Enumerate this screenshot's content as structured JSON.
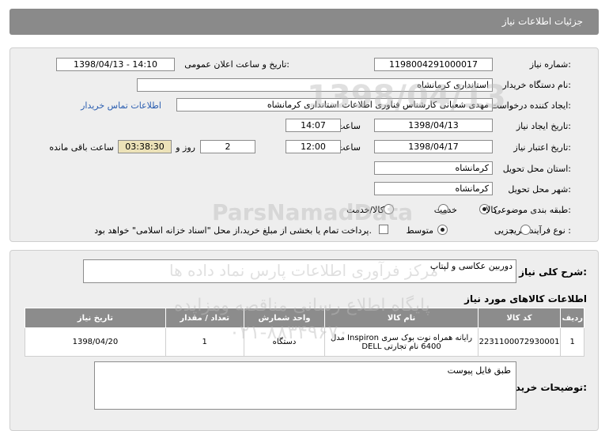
{
  "header": {
    "title": "جزئیات اطلاعات نیاز"
  },
  "form": {
    "need_number_label": "شماره نیاز:",
    "need_number": "1198004291000017",
    "announce_label": "تاریخ و ساعت اعلان عمومی:",
    "announce_value": "1398/04/13 - 14:10",
    "buyer_org_label": "نام دستگاه خریدار:",
    "buyer_org": "استانداری کرمانشاه",
    "creator_label": "ایجاد کننده درخواست:",
    "creator": "مهدی شعبانی کارشناس فناوری اطلاعات استانداری کرمانشاه",
    "contact_link": "اطلاعات تماس خریدار",
    "created_date_label": "تاریخ ایجاد نیاز:",
    "created_date": "1398/04/13",
    "time_label": "ساعت",
    "created_time": "14:07",
    "validity_label": "تاریخ اعتبار نیاز:",
    "validity_date": "1398/04/17",
    "validity_time": "12:00",
    "days_value": "2",
    "days_label": "روز و",
    "remaining_value": "03:38:30",
    "remaining_label": "ساعت باقی مانده",
    "province_label": "استان محل تحویل:",
    "province": "کرمانشاه",
    "city_label": "شهر محل تحویل:",
    "city": "کرمانشاه",
    "category_label": "طبقه بندی موضوعی:",
    "category_options": [
      "کالا",
      "خدمت",
      "کالا/خدمت"
    ],
    "purchase_label": "نوع فرآیند خرید :",
    "purchase_options": [
      "جزیی",
      "متوسط"
    ],
    "treasury_note": "پرداخت تمام یا بخشی از مبلغ خرید،از محل \"اسناد خزانه اسلامی\" خواهد بود."
  },
  "summary": {
    "label": "شرح کلی نیاز:",
    "value": "دوربین عکاسی و لپتاپ"
  },
  "items": {
    "title": "اطلاعات کالاهای مورد نیاز",
    "columns": [
      "ردیف",
      "کد کالا",
      "نام کالا",
      "واحد شمارش",
      "تعداد / مقدار",
      "تاریخ نیاز"
    ],
    "rows": [
      [
        "1",
        "2231100072930001",
        "رایانه همراه نوت بوک سری Inspiron مدل 6400 نام تجارتی DELL",
        "دستگاه",
        "1",
        "1398/04/20"
      ]
    ]
  },
  "buyer_notes": {
    "label": "توضیحات خریدار:",
    "value": "طبق فایل پیوست"
  },
  "watermark": {
    "number": "1398/04/13",
    "site": "ParsNamadData",
    "line1": "مرکز فرآوری اطلاعات پارس نماد داده ها",
    "line2": "پایگاه اطلاع رسانی مناقصه ومزایده",
    "phone": "۰۲۱-۸۸۳۴۹۶۷۰"
  }
}
